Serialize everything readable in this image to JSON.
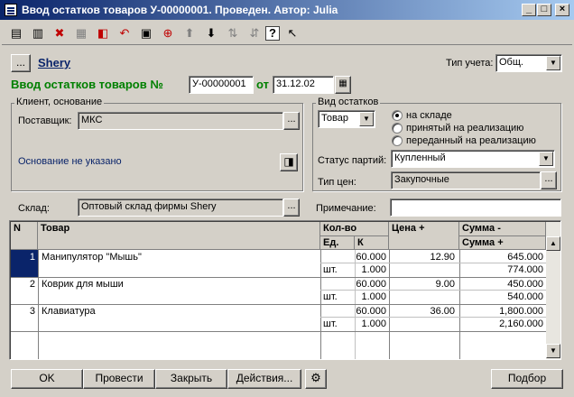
{
  "window": {
    "title": "Ввод остатков товаров У-00000001. Проведен. Автор: Julia",
    "min": "_",
    "max": "□",
    "close": "×"
  },
  "toolbar": {
    "icons": [
      "new-row-icon",
      "copy-row-icon",
      "delete-row-icon",
      "edit-row-icon",
      "mark-delete-icon",
      "undo-icon",
      "group-icon",
      "move-up-icon",
      "move-down-icon",
      "sort-asc-icon",
      "sort-desc-icon",
      "help-icon",
      "context-help-icon"
    ],
    "glyphs": [
      "▤",
      "▥",
      "✖",
      "▦",
      "◧",
      "↶",
      "▣",
      "⬆",
      "⬇",
      "⇅",
      "⇵",
      "?",
      "↖"
    ]
  },
  "header": {
    "select_btn": "...",
    "firm_link": "Shery",
    "doc_caption": "Ввод остатков товаров №",
    "doc_number": "У-00000001",
    "date_label": "от",
    "date_value": "31.12.02",
    "tip_ucheta_label": "Тип учета:",
    "tip_ucheta_value": "Общ."
  },
  "client_group": {
    "title": "Клиент, основание",
    "supplier_label": "Поставщик:",
    "supplier_value": "МКС",
    "basis_link": "Основание не указано"
  },
  "vid_group": {
    "title": "Вид остатков",
    "kind_value": "Товар",
    "radios": [
      {
        "label": "на складе",
        "checked": true
      },
      {
        "label": "принятый на реализацию",
        "checked": false
      },
      {
        "label": "переданный на реализацию",
        "checked": false
      }
    ],
    "status_label": "Статус партий:",
    "status_value": "Купленный",
    "price_label": "Тип цен:",
    "price_value": "Закупочные"
  },
  "warehouse": {
    "label": "Склад:",
    "value": "Оптовый склад фирмы Shery",
    "note_label": "Примечание:",
    "note_value": ""
  },
  "table": {
    "headers": {
      "n": "N",
      "item": "Товар",
      "qty": "Кол-во",
      "unit": "Ед.",
      "k": "К",
      "price": "Цена +",
      "sum1": "Сумма -",
      "sum2": "Сумма +"
    },
    "rows": [
      {
        "n": "1",
        "item": "Манипулятор \"Мышь\"",
        "qty": "60.000",
        "unit": "шт.",
        "k": "1.000",
        "price": "12.90",
        "sum_minus": "645.000",
        "sum_plus": "774.000"
      },
      {
        "n": "2",
        "item": "Коврик для мыши",
        "qty": "60.000",
        "unit": "шт.",
        "k": "1.000",
        "price": "9.00",
        "sum_minus": "450.000",
        "sum_plus": "540.000"
      },
      {
        "n": "3",
        "item": "Клавиатура",
        "qty": "60.000",
        "unit": "шт.",
        "k": "1.000",
        "price": "36.00",
        "sum_minus": "1,800.000",
        "sum_plus": "2,160.000"
      }
    ]
  },
  "footer": {
    "ok": "OK",
    "post": "Провести",
    "close": "Закрыть",
    "actions": "Действия...",
    "selection": "Подбор"
  }
}
